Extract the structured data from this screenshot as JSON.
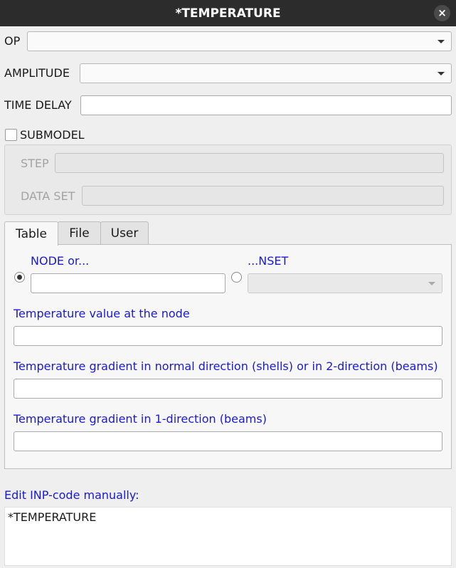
{
  "window": {
    "title": "*TEMPERATURE",
    "close_glyph": "×"
  },
  "form": {
    "op_label": "OP",
    "op_value": "",
    "amplitude_label": "AMPLITUDE",
    "amplitude_value": "",
    "time_delay_label": "TIME DELAY",
    "time_delay_value": "",
    "submodel_label": "SUBMODEL",
    "submodel_checked": false,
    "step_label": "STEP",
    "data_set_label": "DATA SET"
  },
  "tabs": [
    {
      "label": "Table",
      "active": true
    },
    {
      "label": "File",
      "active": false
    },
    {
      "label": "User",
      "active": false
    }
  ],
  "table_tab": {
    "node_label": "NODE or...",
    "node_selected": true,
    "nset_label": "...NSET",
    "nset_selected": false,
    "temp_value_label": "Temperature value at the node",
    "temp_gradient_normal_label": "Temperature gradient in normal direction (shells) or in 2-direction (beams)",
    "temp_gradient_1dir_label": "Temperature gradient in 1-direction (beams)"
  },
  "editor": {
    "label": "Edit INP-code manually:",
    "content": "*TEMPERATURE"
  },
  "colors": {
    "title_bg": "#2c2c2c",
    "link_blue": "#1a1ad6"
  }
}
